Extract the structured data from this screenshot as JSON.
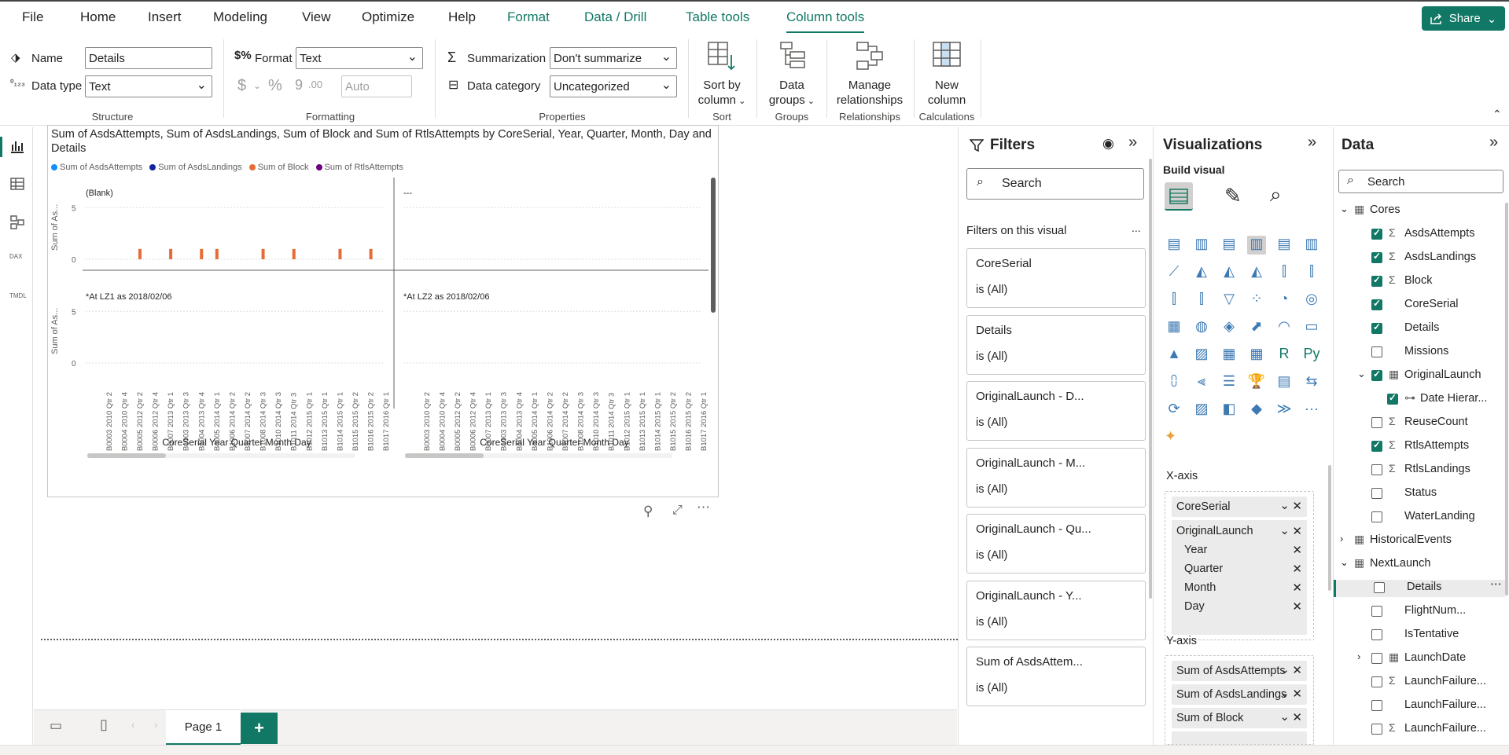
{
  "menu": {
    "items": [
      "File",
      "Home",
      "Insert",
      "Modeling",
      "View",
      "Optimize",
      "Help"
    ],
    "context_tabs": [
      "Format",
      "Data / Drill",
      "Table tools",
      "Column tools"
    ],
    "active_tab": "Column tools",
    "share_label": "Share"
  },
  "ribbon": {
    "structure": {
      "name_label": "Name",
      "name_value": "Details",
      "datatype_label": "Data type",
      "datatype_value": "Text",
      "group": "Structure"
    },
    "formatting": {
      "format_label": "Format",
      "format_value": "Text",
      "currency_symbol": "$",
      "percent_symbol": "%",
      "comma_symbol": "9",
      "decimal_symbol": ".00",
      "auto_value": "Auto",
      "group": "Formatting"
    },
    "properties": {
      "summarization_label": "Summarization",
      "summarization_value": "Don't summarize",
      "category_label": "Data category",
      "category_value": "Uncategorized",
      "group": "Properties"
    },
    "sort": {
      "btn_line1": "Sort by",
      "btn_line2": "column",
      "group": "Sort"
    },
    "groups": {
      "btn_line1": "Data",
      "btn_line2": "groups",
      "group": "Groups"
    },
    "relationships": {
      "btn_line1": "Manage",
      "btn_line2": "relationships",
      "group": "Relationships"
    },
    "calculations": {
      "btn_line1": "New",
      "btn_line2": "column",
      "group": "Calculations"
    }
  },
  "visual": {
    "title": "Sum of AsdsAttempts, Sum of AsdsLandings, Sum of Block and Sum of RtlsAttempts by CoreSerial, Year, Quarter, Month, Day and Details",
    "legend": [
      {
        "name": "Sum of AsdsAttempts",
        "color": "#118DFF"
      },
      {
        "name": "Sum of AsdsLandings",
        "color": "#12239E"
      },
      {
        "name": "Sum of Block",
        "color": "#E66C37"
      },
      {
        "name": "Sum of RtlsAttempts",
        "color": "#6B007B"
      }
    ],
    "panels": [
      "(Blank)",
      "---",
      "*At LZ1 as 2018/02/06",
      "*At LZ2 as 2018/02/06"
    ],
    "ylabel": "Sum of As...",
    "xlabel": "CoreSerial Year Quarter Month Day",
    "yticks": [
      "5",
      "0"
    ]
  },
  "chart_data": {
    "type": "bar",
    "title": "Sum of AsdsAttempts, Sum of AsdsLandings, Sum of Block and Sum of RtlsAttempts by CoreSerial, Year, Quarter, Month, Day and Details",
    "xlabel": "CoreSerial Year Quarter Month Day",
    "ylabel": "Sum of As...",
    "ylim": [
      0,
      7
    ],
    "small_multiples": [
      "(Blank)",
      "---",
      "*At LZ1 as 2018/02/06",
      "*At LZ2 as 2018/02/06"
    ],
    "categories": [
      "B0003 2010 Qtr 2",
      "B0004 2010 Qtr 4",
      "B0005 2012 Qtr 2",
      "B0006 2012 Qtr 4",
      "B0007 2013 Qtr 1",
      "B1003 2013 Qtr 3",
      "B1004 2013 Qtr 4",
      "B1005 2014 Qtr 1",
      "B1006 2014 Qtr 2",
      "B1007 2014 Qtr 2",
      "B1008 2014 Qtr 3",
      "B1010 2014 Qtr 3",
      "B1011 2014 Qtr 3",
      "B1012 2015 Qtr 1",
      "B1013 2015 Qtr 1",
      "B1014 2015 Qtr 1",
      "B1015 2015 Qtr 2",
      "B1016 2015 Qtr 2",
      "B1017 2016 Qtr 1"
    ],
    "series": [
      {
        "name": "Sum of Block",
        "panel": "(Blank)",
        "values": [
          0,
          0,
          1,
          0,
          1,
          0,
          1,
          1,
          0,
          0,
          1,
          0,
          1,
          0,
          0,
          1,
          0,
          1,
          0
        ]
      }
    ],
    "legend": "top-left",
    "grid": true
  },
  "filters": {
    "title": "Filters",
    "search_placeholder": "Search",
    "section": "Filters on this visual",
    "more": "...",
    "cards": [
      {
        "name": "CoreSerial",
        "value": "is (All)"
      },
      {
        "name": "Details",
        "value": "is (All)"
      },
      {
        "name": "OriginalLaunch - D...",
        "value": "is (All)"
      },
      {
        "name": "OriginalLaunch - M...",
        "value": "is (All)"
      },
      {
        "name": "OriginalLaunch - Qu...",
        "value": "is (All)"
      },
      {
        "name": "OriginalLaunch - Y...",
        "value": "is (All)"
      },
      {
        "name": "Sum of AsdsAttem...",
        "value": "is (All)"
      }
    ]
  },
  "visualizations": {
    "title": "Visualizations",
    "build_label": "Build visual",
    "xaxis_label": "X-axis",
    "xaxis_fields": [
      "CoreSerial",
      "OriginalLaunch"
    ],
    "xaxis_subfields": [
      "Year",
      "Quarter",
      "Month",
      "Day"
    ],
    "yaxis_label": "Y-axis",
    "yaxis_fields": [
      "Sum of AsdsAttempts",
      "Sum of AsdsLandings",
      "Sum of Block"
    ],
    "more": "..."
  },
  "data_pane": {
    "title": "Data",
    "search_placeholder": "Search",
    "tree": [
      {
        "label": "Cores",
        "kind": "table",
        "expanded": true,
        "checked": null,
        "level": 0
      },
      {
        "label": "AsdsAttempts",
        "kind": "sum",
        "checked": true,
        "level": 1
      },
      {
        "label": "AsdsLandings",
        "kind": "sum",
        "checked": true,
        "level": 1
      },
      {
        "label": "Block",
        "kind": "sum",
        "checked": true,
        "level": 1
      },
      {
        "label": "CoreSerial",
        "kind": "field",
        "checked": true,
        "level": 1
      },
      {
        "label": "Details",
        "kind": "field",
        "checked": true,
        "level": 1
      },
      {
        "label": "Missions",
        "kind": "field",
        "checked": false,
        "level": 1
      },
      {
        "label": "OriginalLaunch",
        "kind": "date",
        "checked": true,
        "level": 1,
        "expanded": true
      },
      {
        "label": "Date Hierar...",
        "kind": "hier",
        "checked": true,
        "level": 2
      },
      {
        "label": "ReuseCount",
        "kind": "sum",
        "checked": false,
        "level": 1
      },
      {
        "label": "RtlsAttempts",
        "kind": "sum",
        "checked": true,
        "level": 1
      },
      {
        "label": "RtlsLandings",
        "kind": "sum",
        "checked": false,
        "level": 1
      },
      {
        "label": "Status",
        "kind": "field",
        "checked": false,
        "level": 1
      },
      {
        "label": "WaterLanding",
        "kind": "field",
        "checked": false,
        "level": 1
      },
      {
        "label": "HistoricalEvents",
        "kind": "table",
        "expanded": false,
        "checked": null,
        "level": 0
      },
      {
        "label": "NextLaunch",
        "kind": "table",
        "expanded": true,
        "checked": null,
        "level": 0
      },
      {
        "label": "Details",
        "kind": "field",
        "checked": false,
        "level": 1,
        "selected": true
      },
      {
        "label": "FlightNum...",
        "kind": "field",
        "checked": false,
        "level": 1
      },
      {
        "label": "IsTentative",
        "kind": "field",
        "checked": false,
        "level": 1
      },
      {
        "label": "LaunchDate",
        "kind": "date",
        "checked": false,
        "level": 1,
        "expanded": false
      },
      {
        "label": "LaunchFailure...",
        "kind": "sum",
        "checked": false,
        "level": 1
      },
      {
        "label": "LaunchFailure...",
        "kind": "field",
        "checked": false,
        "level": 1
      },
      {
        "label": "LaunchFailure...",
        "kind": "sum",
        "checked": false,
        "level": 1
      }
    ]
  },
  "pages": {
    "tab": "Page 1",
    "add": "+"
  },
  "colors": {
    "accent": "#117865",
    "block": "#E66C37"
  }
}
